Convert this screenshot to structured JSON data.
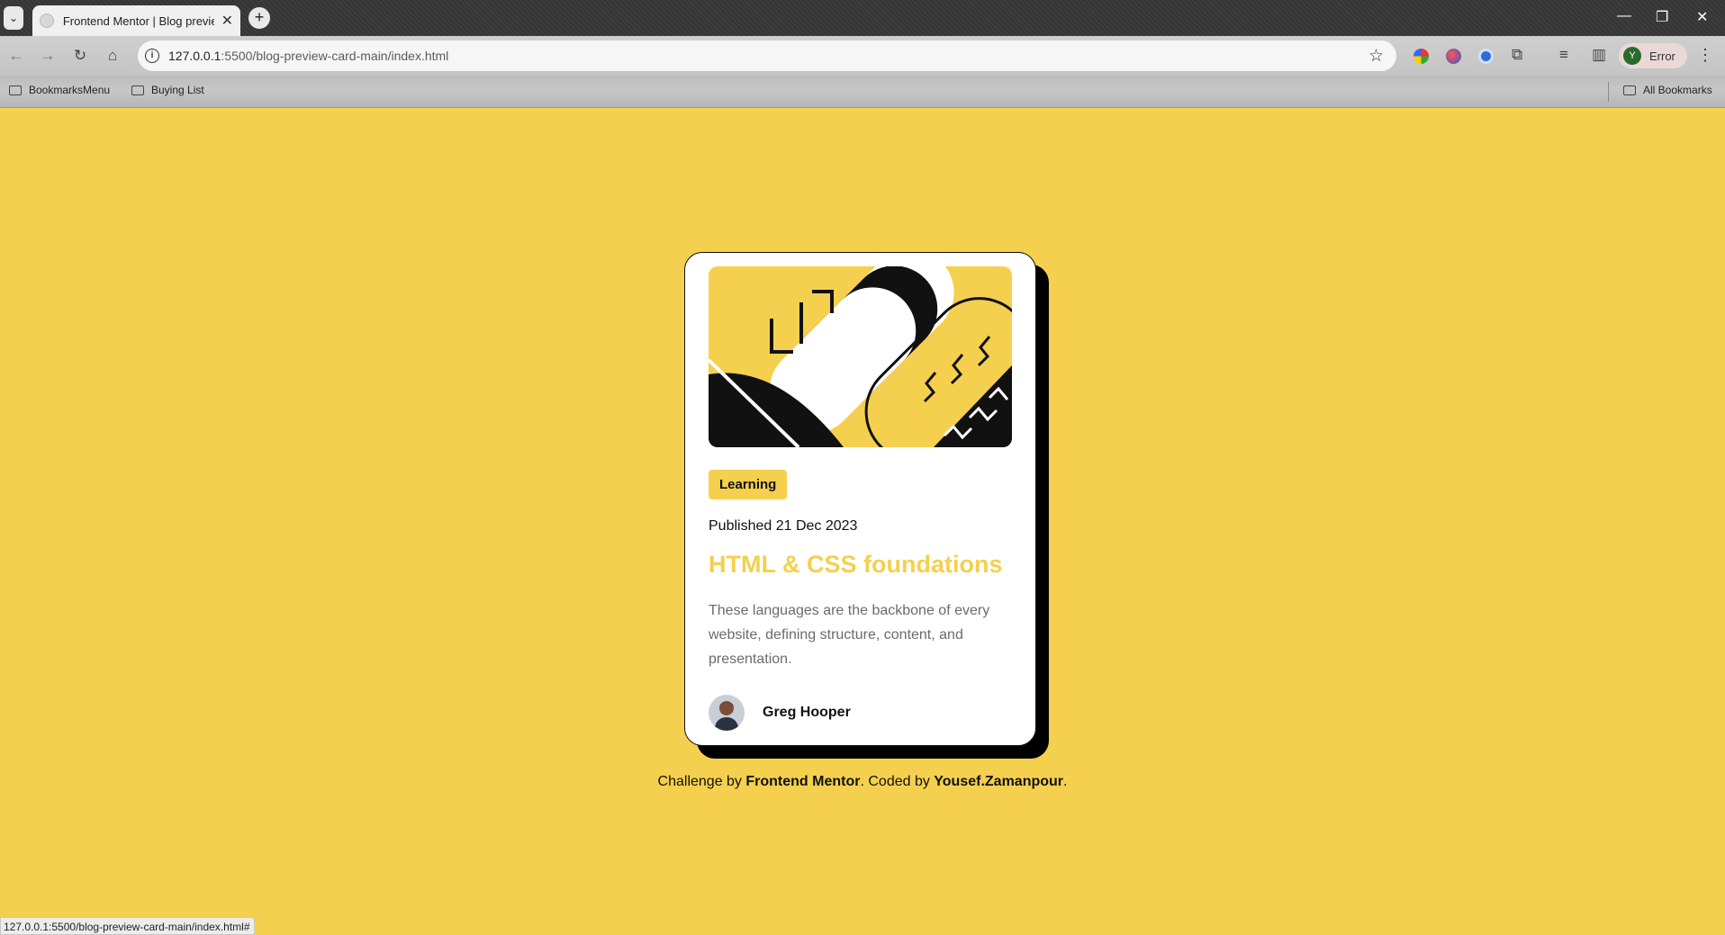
{
  "browser": {
    "tab_title": "Frontend Mentor | Blog preview card",
    "tab_close": "✕",
    "new_tab": "+",
    "url_host": "127.0.0.1",
    "url_path": ":5500/blog-preview-card-main/index.html",
    "profile_initial": "Y",
    "profile_label": "Error",
    "bookmarks": [
      "BookmarksMenu",
      "Buying List"
    ],
    "all_bookmarks": "All Bookmarks",
    "status_url": "127.0.0.1:5500/blog-preview-card-main/index.html#"
  },
  "card": {
    "tag": "Learning",
    "published": "Published 21 Dec 2023",
    "title": "HTML & CSS foundations",
    "description": "These languages are the backbone of every website, defining structure, content, and presentation.",
    "author": "Greg Hooper"
  },
  "attribution": {
    "prefix": "Challenge by ",
    "link1": "Frontend Mentor",
    "middle": ". Coded by ",
    "link2": "Yousef.Zamanpour",
    "suffix": "."
  },
  "colors": {
    "background": "#f4d04e",
    "accent": "#f4d04e",
    "text": "#111111",
    "muted": "#6b6b6b"
  }
}
